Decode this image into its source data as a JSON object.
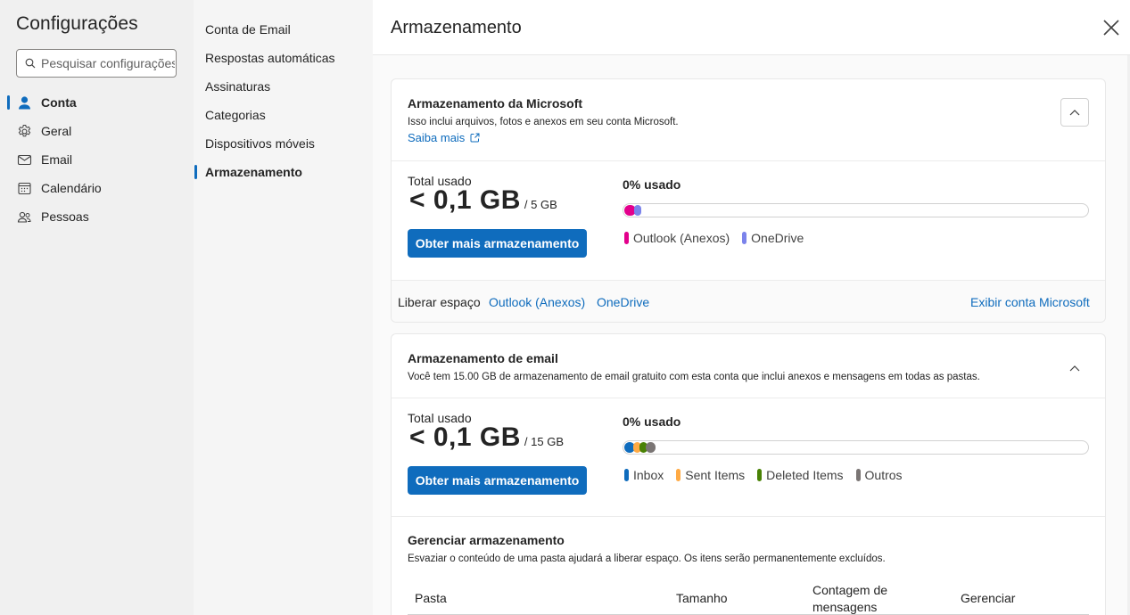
{
  "nav": {
    "title": "Configurações",
    "search_placeholder": "Pesquisar configurações",
    "items": [
      {
        "label": "Conta",
        "icon": "person-icon",
        "active": true
      },
      {
        "label": "Geral",
        "icon": "gear-icon",
        "active": false
      },
      {
        "label": "Email",
        "icon": "mail-icon",
        "active": false
      },
      {
        "label": "Calendário",
        "icon": "calendar-icon",
        "active": false
      },
      {
        "label": "Pessoas",
        "icon": "people-icon",
        "active": false
      }
    ]
  },
  "subnav": {
    "items": [
      {
        "label": "Conta de Email",
        "active": false
      },
      {
        "label": "Respostas automáticas",
        "active": false
      },
      {
        "label": "Assinaturas",
        "active": false
      },
      {
        "label": "Categorias",
        "active": false
      },
      {
        "label": "Dispositivos móveis",
        "active": false
      },
      {
        "label": "Armazenamento",
        "active": true
      }
    ]
  },
  "main": {
    "title": "Armazenamento",
    "close_icon": "close-icon"
  },
  "microsoft_storage": {
    "title": "Armazenamento da Microsoft",
    "description": "Isso inclui arquivos, fotos e anexos em seu conta Microsoft.",
    "learn_more": "Saiba mais",
    "total_label": "Total usado",
    "total_value": "< 0,1 GB",
    "total_of": "/ 5 GB",
    "button": "Obter mais armazenamento",
    "percent_label": "0% usado",
    "usage_fraction": 0.0,
    "legend": [
      {
        "label": "Outlook (Anexos)",
        "color": "#e3008c"
      },
      {
        "label": "OneDrive",
        "color": "#7b83eb"
      }
    ],
    "free_space_label": "Liberar espaço",
    "free_space_links": [
      "Outlook (Anexos)",
      "OneDrive"
    ],
    "view_account": "Exibir conta Microsoft"
  },
  "email_storage": {
    "title": "Armazenamento de email",
    "description": "Você tem 15.00 GB de armazenamento de email gratuito com esta conta que inclui anexos e mensagens em todas as pastas.",
    "total_label": "Total usado",
    "total_value": "< 0,1 GB",
    "total_of": "/ 15 GB",
    "button": "Obter mais armazenamento",
    "percent_label": "0% usado",
    "usage_fraction": 0.0,
    "legend": [
      {
        "label": "Inbox",
        "color": "#0f6cbd"
      },
      {
        "label": "Sent Items",
        "color": "#ffaa44"
      },
      {
        "label": "Deleted Items",
        "color": "#498205"
      },
      {
        "label": "Outros",
        "color": "#7a7574"
      }
    ]
  },
  "manage_storage": {
    "title": "Gerenciar armazenamento",
    "description": "Esvaziar o conteúdo de uma pasta ajudará a liberar espaço. Os itens serão permanentemente excluídos.",
    "columns": [
      "Pasta",
      "Tamanho",
      "Contagem de mensagens",
      "Gerenciar"
    ]
  }
}
